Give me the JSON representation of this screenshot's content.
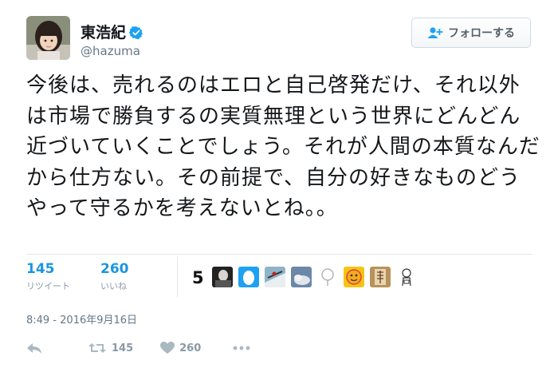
{
  "user": {
    "display_name": "東浩紀",
    "handle": "@hazuma",
    "verified": true
  },
  "follow_button": {
    "label": "フォローする",
    "icon": "add-user-icon"
  },
  "tweet": {
    "text": "今後は、売れるのはエロと自己啓発だけ、それ以外は市場で勝負するの実質無理という世界にどんどん近づいていくことでしょう。それが人間の本質なんだから仕方ない。その前提で、自分の好きなものどうやって守るかを考えないとね。。"
  },
  "stats": {
    "retweets": {
      "count": "145",
      "label": "リツイート"
    },
    "likes": {
      "count": "260",
      "label": "いいね"
    }
  },
  "likers": {
    "count_label": "5",
    "avatars": [
      "portrait",
      "blue-egg",
      "ski-jump",
      "cloud-sky",
      "tree-sketch",
      "smiley-face",
      "kanji-stamp",
      "doodle-character"
    ]
  },
  "timestamp": "8:49 - 2016年9月16日",
  "actions": {
    "reply": {
      "icon": "reply-icon"
    },
    "retweet": {
      "icon": "retweet-icon",
      "count": "145"
    },
    "like": {
      "icon": "heart-icon",
      "count": "260"
    },
    "more": {
      "icon": "more-icon"
    }
  },
  "colors": {
    "text": "#14171a",
    "secondary": "#657786",
    "accent": "#1b95e0",
    "verified": "#1da1f2",
    "divider": "#e1e8ed"
  }
}
